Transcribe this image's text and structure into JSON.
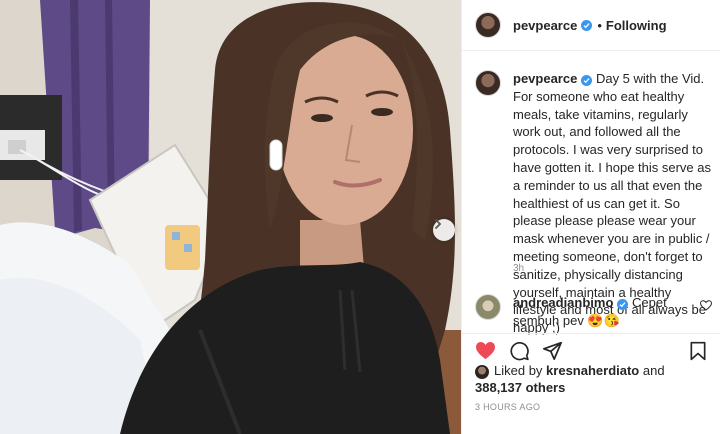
{
  "post": {
    "username": "pevpearce",
    "follow_separator": "•",
    "follow_status": "Following",
    "caption": "Day 5 with the Vid. For someone who eat healthy meals, take vitamins, regularly work out, and followed all the protocols. I was very surprised to have gotten it. I hope this serve as a reminder to us all that even the healthiest of us can get it. So please please please wear your mask whenever you are in public / meeting someone, don't forget to sanitize, physically distancing yourself, maintain a healthy lifestyle and most of all always be happy ;)",
    "caption_age": "3h",
    "verified_color": "#3897f0",
    "like_color": "#ed4956"
  },
  "comment": {
    "username": "andreadianbimo",
    "text": "Cepet sembuh pev 😍😘"
  },
  "likes": {
    "prefix": "Liked by",
    "liker": "kresnaherdiato",
    "suffix": "and",
    "count": "388,137 others"
  },
  "timestamp": "3 HOURS AGO",
  "icons": {
    "like": "heart-filled-icon",
    "comment": "comment-bubble-icon",
    "share": "paper-plane-icon",
    "save": "bookmark-icon",
    "next": "chevron-right-icon",
    "comment_like": "heart-outline-icon"
  }
}
